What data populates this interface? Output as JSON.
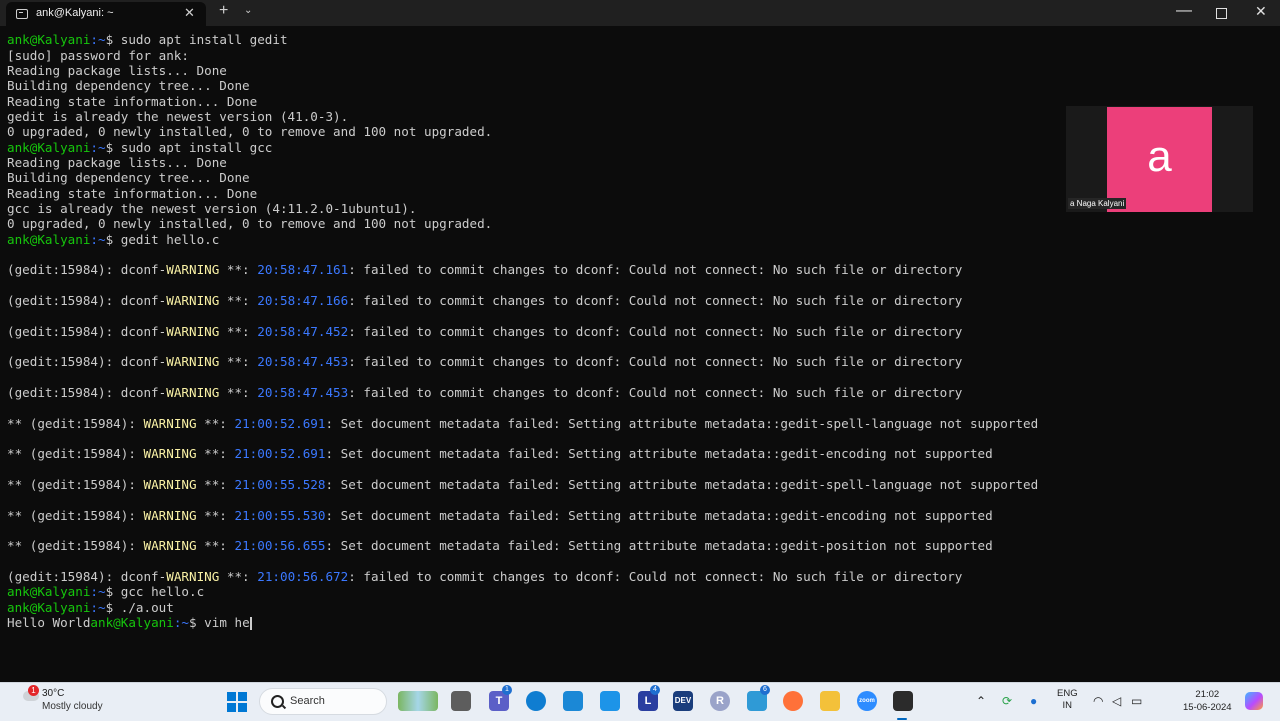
{
  "window": {
    "tab_title": "ank@Kalyani: ~",
    "new_tab": "+",
    "dropdown": "⌄",
    "tab_close": "✕",
    "minimize": "—",
    "close": "✕"
  },
  "terminal": {
    "prompt_user": "ank@Kalyani",
    "prompt_path": ":~",
    "prompt_symbol": "$ ",
    "cmd1": "sudo apt install gedit",
    "out1": "[sudo] password for ank:",
    "out2": "Reading package lists... Done",
    "out3": "Building dependency tree... Done",
    "out4": "Reading state information... Done",
    "out5": "gedit is already the newest version (41.0-3).",
    "out6": "0 upgraded, 0 newly installed, 0 to remove and 100 not upgraded.",
    "cmd2": "sudo apt install gcc",
    "out7": "Reading package lists... Done",
    "out8": "Building dependency tree... Done",
    "out9": "Reading state information... Done",
    "out10": "gcc is already the newest version (4:11.2.0-1ubuntu1).",
    "out11": "0 upgraded, 0 newly installed, 0 to remove and 100 not upgraded.",
    "cmd3": "gedit hello.c",
    "warnings": [
      {
        "prefix": "(gedit:15984): dconf-",
        "level": "WARNING",
        "sep": " **: ",
        "time": "20:58:47.161",
        "msg": ": failed to commit changes to dconf: Could not connect: No such file or directory"
      },
      {
        "prefix": "(gedit:15984): dconf-",
        "level": "WARNING",
        "sep": " **: ",
        "time": "20:58:47.166",
        "msg": ": failed to commit changes to dconf: Could not connect: No such file or directory"
      },
      {
        "prefix": "(gedit:15984): dconf-",
        "level": "WARNING",
        "sep": " **: ",
        "time": "20:58:47.452",
        "msg": ": failed to commit changes to dconf: Could not connect: No such file or directory"
      },
      {
        "prefix": "(gedit:15984): dconf-",
        "level": "WARNING",
        "sep": " **: ",
        "time": "20:58:47.453",
        "msg": ": failed to commit changes to dconf: Could not connect: No such file or directory"
      },
      {
        "prefix": "(gedit:15984): dconf-",
        "level": "WARNING",
        "sep": " **: ",
        "time": "20:58:47.453",
        "msg": ": failed to commit changes to dconf: Could not connect: No such file or directory"
      },
      {
        "prefix": "** (gedit:15984): ",
        "level": "WARNING",
        "sep": " **: ",
        "time": "21:00:52.691",
        "msg": ": Set document metadata failed: Setting attribute metadata::gedit-spell-language not supported"
      },
      {
        "prefix": "** (gedit:15984): ",
        "level": "WARNING",
        "sep": " **: ",
        "time": "21:00:52.691",
        "msg": ": Set document metadata failed: Setting attribute metadata::gedit-encoding not supported"
      },
      {
        "prefix": "** (gedit:15984): ",
        "level": "WARNING",
        "sep": " **: ",
        "time": "21:00:55.528",
        "msg": ": Set document metadata failed: Setting attribute metadata::gedit-spell-language not supported"
      },
      {
        "prefix": "** (gedit:15984): ",
        "level": "WARNING",
        "sep": " **: ",
        "time": "21:00:55.530",
        "msg": ": Set document metadata failed: Setting attribute metadata::gedit-encoding not supported"
      },
      {
        "prefix": "** (gedit:15984): ",
        "level": "WARNING",
        "sep": " **: ",
        "time": "21:00:56.655",
        "msg": ": Set document metadata failed: Setting attribute metadata::gedit-position not supported"
      },
      {
        "prefix": "(gedit:15984): dconf-",
        "level": "WARNING",
        "sep": " **: ",
        "time": "21:00:56.672",
        "msg": ": failed to commit changes to dconf: Could not connect: No such file or directory"
      }
    ],
    "cmd4": "gcc hello.c",
    "cmd5": "./a.out",
    "program_output": "Hello World",
    "cmd6": "vim he",
    "colors": {
      "user": "#16c60c",
      "path": "#3b78ff",
      "warning": "#f9f1a5",
      "timestamp": "#3b78ff",
      "text": "#cccccc",
      "background": "#0c0c0c"
    }
  },
  "video": {
    "avatar_letter": "a",
    "participant_name": "a Naga Kalyani",
    "avatar_color": "#ec3f7a"
  },
  "taskbar": {
    "weather_badge": "1",
    "temperature": "30°C",
    "condition": "Mostly cloudy",
    "search_placeholder": "Search",
    "apps": [
      {
        "icon": "teams-icon",
        "badge": "1"
      },
      {
        "icon": "edge-icon"
      },
      {
        "icon": "store-icon"
      },
      {
        "icon": "photos-icon"
      },
      {
        "icon": "app-l-icon",
        "label": "L",
        "badge": "4"
      },
      {
        "icon": "devhome-icon",
        "label": "DEV"
      },
      {
        "icon": "r-app-icon",
        "label": "R"
      },
      {
        "icon": "app-badge-icon",
        "badge": "6"
      },
      {
        "icon": "firefox-icon"
      },
      {
        "icon": "file-explorer-icon"
      },
      {
        "icon": "zoom-icon",
        "label": "zoom"
      },
      {
        "icon": "terminal-icon"
      }
    ],
    "language": "ENG",
    "region": "IN",
    "time": "21:02",
    "date": "15-06-2024"
  }
}
